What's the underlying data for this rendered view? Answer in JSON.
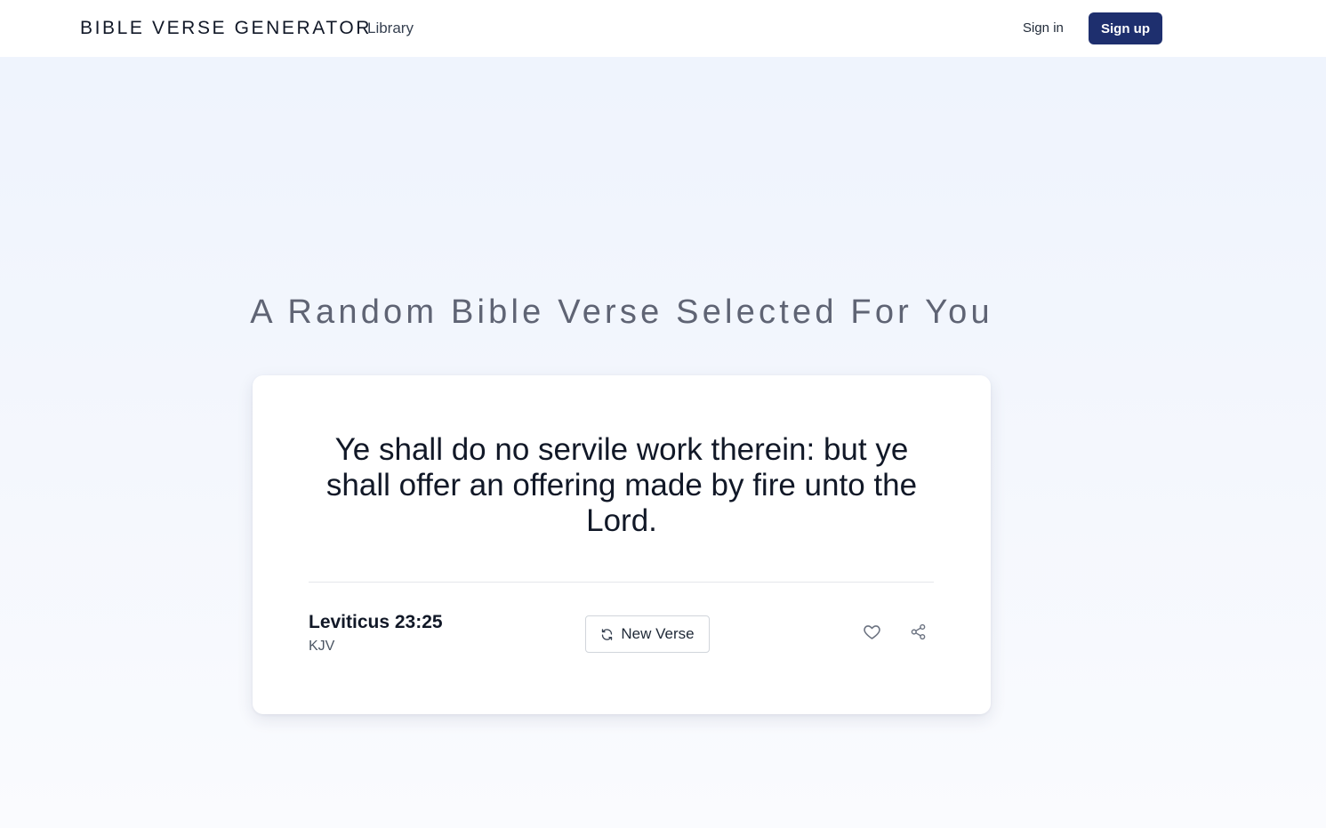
{
  "header": {
    "brand": "BIBLE VERSE GENERATOR",
    "nav_library": "Library",
    "sign_in": "Sign in",
    "sign_up": "Sign up"
  },
  "main": {
    "headline": "A Random Bible Verse Selected For You"
  },
  "verse_card": {
    "text": "Ye shall do no servile work therein: but ye shall offer an offering made by fire unto the Lord.",
    "reference": "Leviticus 23:25",
    "version": "KJV",
    "new_verse_label": "New Verse",
    "refresh_icon": "refresh-icon",
    "like_icon": "heart-icon",
    "share_icon": "share-icon"
  },
  "colors": {
    "accent": "#1e2f6e",
    "background": "#eef3fd",
    "card": "#ffffff",
    "headline": "#5f6474"
  }
}
